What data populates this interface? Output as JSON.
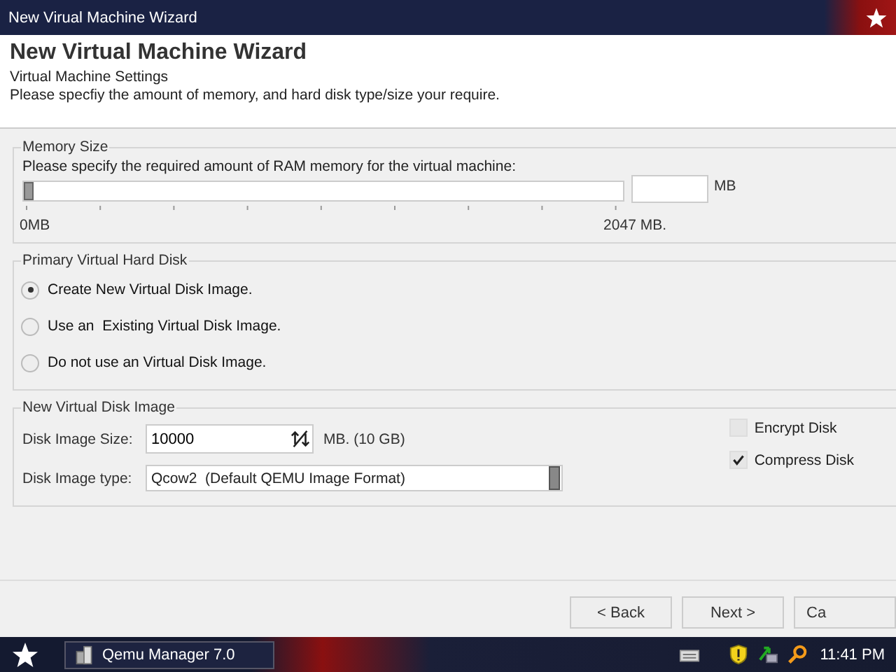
{
  "window": {
    "title": "New Virual Machine Wizard"
  },
  "header": {
    "title": "New Virtual Machine Wizard",
    "subtitle": "Virtual Machine Settings",
    "description": "Please specfiy the amount of memory, and hard disk type/size your require."
  },
  "memory": {
    "legend": "Memory Size",
    "prompt": "Please specify the required amount of RAM memory for the virtual machine:",
    "slider": {
      "level": 0,
      "min_label": "0MB",
      "max_label": "2047 MB."
    },
    "unit": "MB"
  },
  "primary_disk": {
    "legend": "Primary Virtual Hard Disk",
    "options": [
      {
        "label": "Create New Virtual Disk Image.",
        "selected": true
      },
      {
        "label": "Use an  Existing Virtual Disk Image.",
        "selected": false
      },
      {
        "label": "Do not use an Virtual Disk Image.",
        "selected": false
      }
    ]
  },
  "new_disk": {
    "legend": "New Virtual Disk Image",
    "size_label": "Disk Image Size:",
    "size_value": "10000",
    "size_unit": "MB. (10 GB)",
    "type_label": "Disk Image type:",
    "type_value": "Qcow2  (Default QEMU Image Format)",
    "options": [
      {
        "label": "Encrypt Disk",
        "checked": false
      },
      {
        "label": "Compress Disk",
        "checked": true
      }
    ]
  },
  "buttons": [
    {
      "label": "< Back"
    },
    {
      "label": "Next >"
    },
    {
      "label": "Ca"
    }
  ],
  "taskbar": {
    "task": "Qemu Manager 7.0",
    "clock": "11:41 PM"
  }
}
